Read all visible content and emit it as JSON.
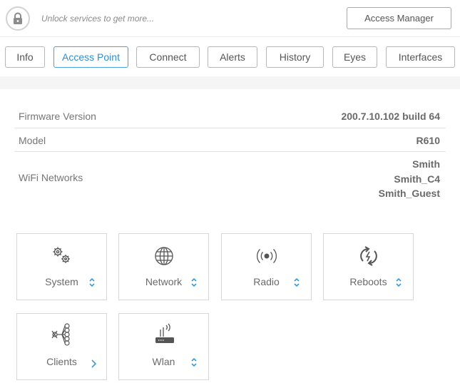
{
  "topbar": {
    "lock_icon": "lock-icon",
    "unlock_text": "Unlock services to get more...",
    "access_manager_label": "Access Manager"
  },
  "tabs": [
    {
      "label": "Info",
      "active": false
    },
    {
      "label": "Access Point",
      "active": true
    },
    {
      "label": "Connect",
      "active": false
    },
    {
      "label": "Alerts",
      "active": false
    },
    {
      "label": "History",
      "active": false
    },
    {
      "label": "Eyes",
      "active": false
    },
    {
      "label": "Interfaces",
      "active": false
    }
  ],
  "info": {
    "firmware_label": "Firmware Version",
    "firmware_value": "200.7.10.102 build 64",
    "model_label": "Model",
    "model_value": "R610",
    "wifi_label": "WiFi Networks",
    "wifi_networks": [
      "Smith",
      "Smith_C4",
      "Smith_Guest"
    ]
  },
  "tiles": [
    {
      "label": "System",
      "icon": "gears-icon",
      "control": "sort-icon"
    },
    {
      "label": "Network",
      "icon": "globe-icon",
      "control": "sort-icon"
    },
    {
      "label": "Radio",
      "icon": "broadcast-icon",
      "control": "sort-icon"
    },
    {
      "label": "Reboots",
      "icon": "reboot-icon",
      "control": "sort-icon"
    },
    {
      "label": "Clients",
      "icon": "clients-tree-icon",
      "control": "chevron-right-icon"
    },
    {
      "label": "Wlan",
      "icon": "router-icon",
      "control": "sort-icon"
    }
  ],
  "colors": {
    "accent": "#3b9be0",
    "active_tab_border": "#4aa3df"
  }
}
